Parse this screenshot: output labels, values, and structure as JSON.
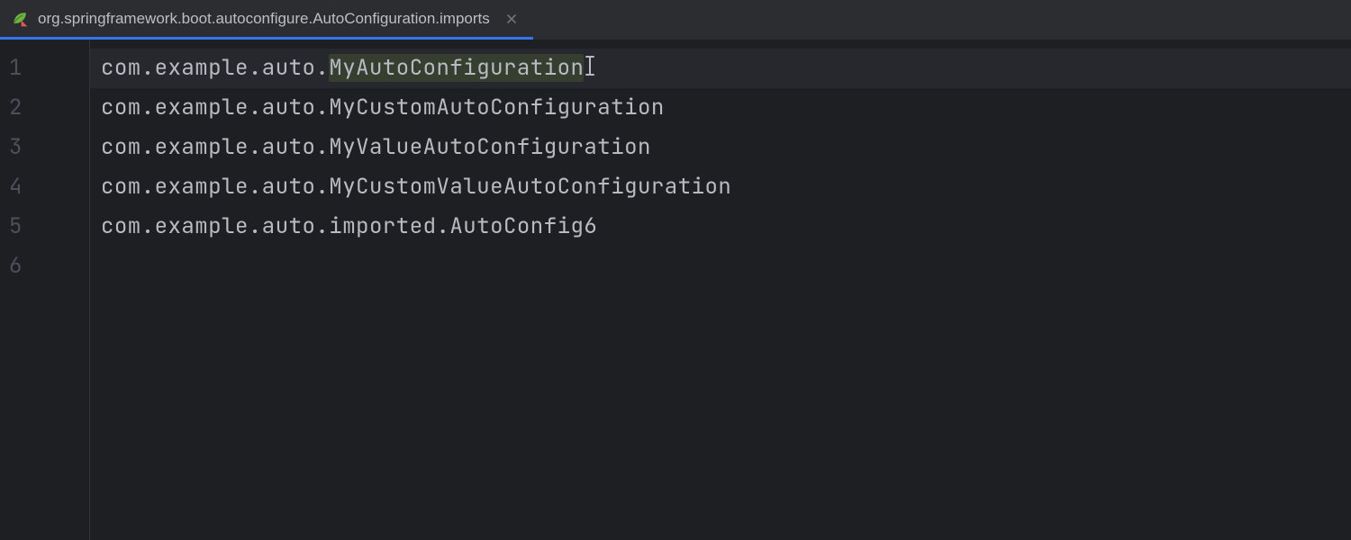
{
  "tab": {
    "label": "org.springframework.boot.autoconfigure.AutoConfiguration.imports"
  },
  "editor": {
    "lines": [
      {
        "num": "1",
        "prefix": "com.example.auto.",
        "hl": "MyAutoConfiguration",
        "suffix": "",
        "current": true
      },
      {
        "num": "2",
        "prefix": "com.example.auto.MyCustomAutoConfiguration",
        "hl": "",
        "suffix": "",
        "current": false
      },
      {
        "num": "3",
        "prefix": "com.example.auto.MyValueAutoConfiguration",
        "hl": "",
        "suffix": "",
        "current": false
      },
      {
        "num": "4",
        "prefix": "com.example.auto.MyCustomValueAutoConfiguration",
        "hl": "",
        "suffix": "",
        "current": false
      },
      {
        "num": "5",
        "prefix": "com.example.auto.imported.AutoConfig6",
        "hl": "",
        "suffix": "",
        "current": false
      },
      {
        "num": "6",
        "prefix": "",
        "hl": "",
        "suffix": "",
        "current": false
      }
    ]
  }
}
